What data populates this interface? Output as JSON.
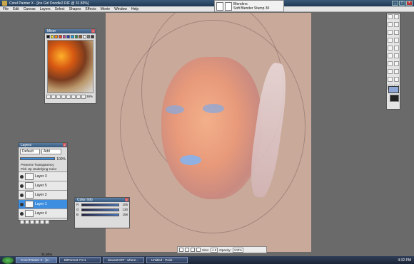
{
  "window": {
    "title": "Corel Painter X - [Ice Girl Doodle2.RIF @ 31.83%]"
  },
  "menu": [
    "File",
    "Edit",
    "Canvas",
    "Layers",
    "Select",
    "Shapes",
    "Effects",
    "Movie",
    "Window",
    "Help"
  ],
  "property_bar": {
    "category": "Blenders",
    "variant": "Soft Blender Stump 30"
  },
  "mixer": {
    "title": "Mixer",
    "zoom": "38%",
    "swatch_colors": [
      "#111111",
      "#f2e21a",
      "#ff8a00",
      "#e83c1e",
      "#c43c9a",
      "#2c3fb6",
      "#1aa0d8",
      "#1a9a3a",
      "#8b5a2b",
      "#ffffff",
      "#777777",
      "#333333"
    ]
  },
  "layers": {
    "title": "Layers",
    "composite": "Default",
    "method": "Add",
    "opacity": "100%",
    "preserve": "Preserve Transparency",
    "pickup": "Pick Up Underlying Color",
    "items": [
      {
        "name": "Layer 3",
        "selected": false
      },
      {
        "name": "Layer 5",
        "selected": false
      },
      {
        "name": "Layer 2",
        "selected": false
      },
      {
        "name": "Layer 1",
        "selected": true
      },
      {
        "name": "Layer 4",
        "selected": false
      }
    ]
  },
  "color_info": {
    "title": "Color Info",
    "r": "105",
    "g": "130",
    "b": "158"
  },
  "bottom": {
    "size_label": "Size:",
    "size": "4.8",
    "opacity_label": "Opacity:",
    "opacity": "100%"
  },
  "status": {
    "zoom": "31.83%"
  },
  "taskbar": {
    "tasks": [
      "Corel Painter X - [Ic...",
      "BitTorrent 7.8.1",
      "deviantART : where...",
      "Untitled - Paint"
    ],
    "clock": "4:32 PM"
  }
}
